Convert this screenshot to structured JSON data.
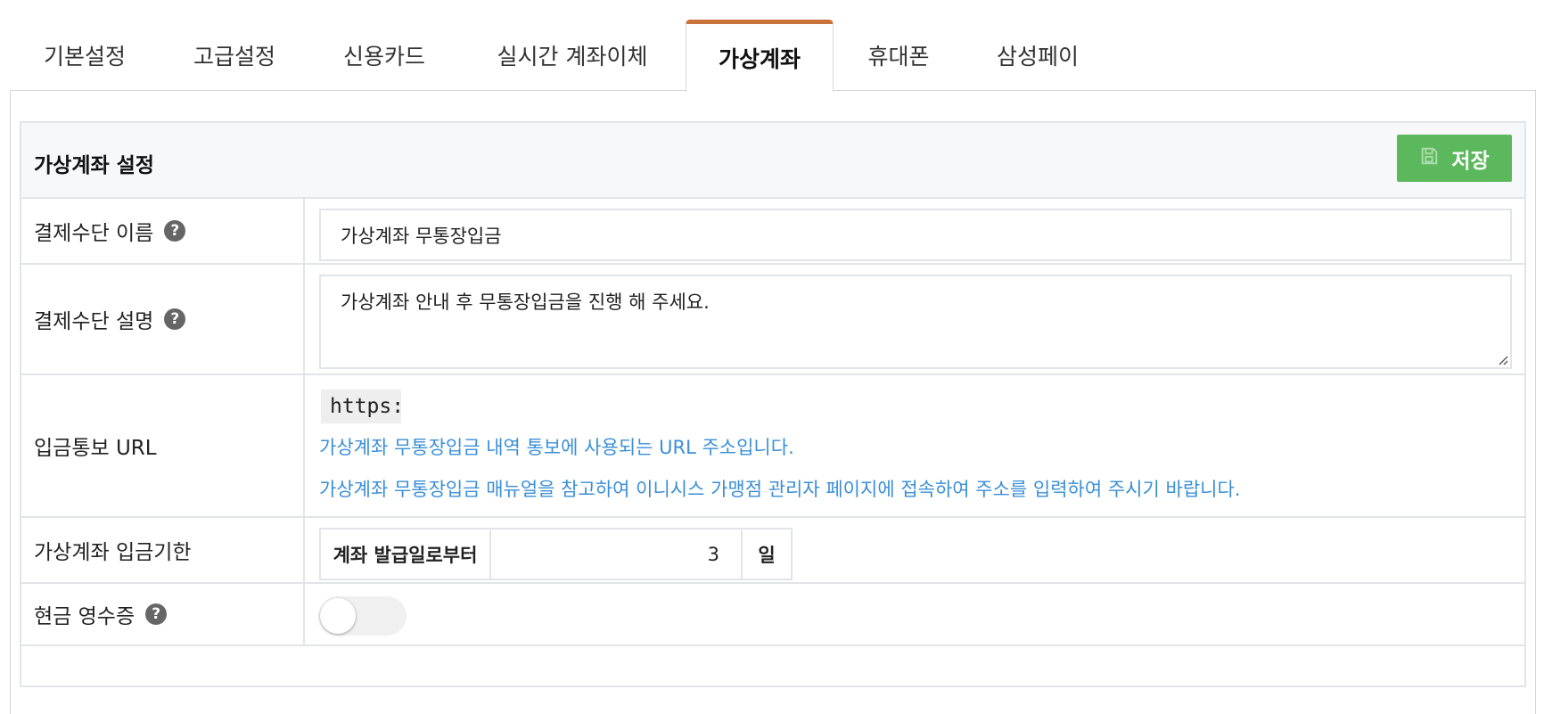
{
  "tabs": [
    {
      "label": "기본설정",
      "active": false
    },
    {
      "label": "고급설정",
      "active": false
    },
    {
      "label": "신용카드",
      "active": false
    },
    {
      "label": "실시간 계좌이체",
      "active": false
    },
    {
      "label": "가상계좌",
      "active": true
    },
    {
      "label": "휴대폰",
      "active": false
    },
    {
      "label": "삼성페이",
      "active": false
    }
  ],
  "accent_color": "#c8733a",
  "save_color": "#5cb85c",
  "link_color": "#3b8fd6",
  "section": {
    "title": "가상계좌 설정",
    "save_label": "저장",
    "save_icon": "floppy-disk-icon"
  },
  "fields": {
    "method_name": {
      "label": "결제수단 이름",
      "value": "가상계좌 무통장입금",
      "help_icon": "question-circle-icon"
    },
    "method_desc": {
      "label": "결제수단 설명",
      "value": "가상계좌 안내 후 무통장입금을 진행 해 주세요.",
      "help_icon": "question-circle-icon"
    },
    "notify_url": {
      "label": "입금통보 URL",
      "value": "https://",
      "note1": "가상계좌 무통장입금 내역 통보에 사용되는 URL 주소입니다.",
      "note2": "가상계좌 무통장입금 매뉴얼을 참고하여 이니시스 가맹점 관리자 페이지에 접속하여 주소를 입력하여 주시기 바랍니다."
    },
    "deadline": {
      "label": "가상계좌 입금기한",
      "prefix": "계좌 발급일로부터",
      "value": "3",
      "suffix": "일"
    },
    "cash_receipt": {
      "label": "현금 영수증",
      "enabled": false,
      "help_icon": "question-circle-icon"
    }
  }
}
